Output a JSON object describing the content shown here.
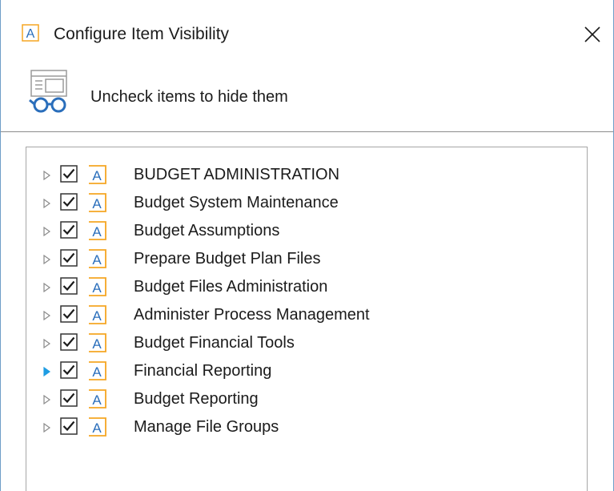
{
  "window": {
    "title": "Configure Item Visibility",
    "app_icon_letter": "A",
    "close_glyph": "×"
  },
  "header": {
    "instruction": "Uncheck items to hide them",
    "icon": "visibility-glasses-icon"
  },
  "colors": {
    "accent_orange": "#f5a623",
    "accent_blue": "#2a6ebb",
    "expander_gray": "#8a8a8a",
    "expander_active": "#1e9ce3"
  },
  "tree": {
    "items": [
      {
        "label": "BUDGET ADMINISTRATION",
        "checked": true,
        "icon_letter": "A",
        "expander_active": false
      },
      {
        "label": "Budget System Maintenance",
        "checked": true,
        "icon_letter": "A",
        "expander_active": false
      },
      {
        "label": "Budget Assumptions",
        "checked": true,
        "icon_letter": "A",
        "expander_active": false
      },
      {
        "label": "Prepare Budget Plan Files",
        "checked": true,
        "icon_letter": "A",
        "expander_active": false
      },
      {
        "label": "Budget Files Administration",
        "checked": true,
        "icon_letter": "A",
        "expander_active": false
      },
      {
        "label": "Administer Process Management",
        "checked": true,
        "icon_letter": "A",
        "expander_active": false
      },
      {
        "label": "Budget Financial Tools",
        "checked": true,
        "icon_letter": "A",
        "expander_active": false
      },
      {
        "label": "Financial Reporting",
        "checked": true,
        "icon_letter": "A",
        "expander_active": true
      },
      {
        "label": "Budget Reporting",
        "checked": true,
        "icon_letter": "A",
        "expander_active": false
      },
      {
        "label": "Manage File Groups",
        "checked": true,
        "icon_letter": "A",
        "expander_active": false
      }
    ]
  }
}
